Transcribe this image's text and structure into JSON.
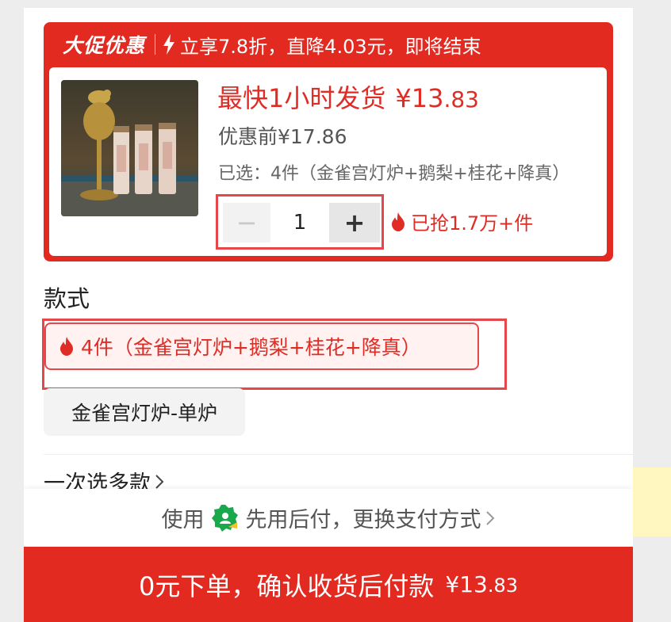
{
  "promo": {
    "badge": "大促优惠",
    "text": "立享7.8折，直降4.03元，即将结束",
    "ship_text": "最快1小时发货",
    "price_int": "¥13",
    "price_dec": ".83",
    "original_price": "优惠前¥17.86",
    "selected": "已选：4件（金雀宫灯炉+鹅梨+桂花+降真）",
    "quantity": "1",
    "minus": "−",
    "plus": "+",
    "sold": "已抢1.7万+件"
  },
  "style_section": {
    "title": "款式",
    "options": [
      {
        "label": "4件（金雀宫灯炉+鹅梨+桂花+降真）",
        "selected": true
      },
      {
        "label": "金雀宫灯炉-单炉",
        "selected": false
      }
    ]
  },
  "multi_select": {
    "label": "一次选多款"
  },
  "payment": {
    "prefix": "使用",
    "method": "先用后付，更换支付方式"
  },
  "cta": {
    "label": "0元下单，确认收货后付款",
    "amount_int": "¥13",
    "amount_dec": ".83"
  },
  "colors": {
    "brand_red": "#e22a21",
    "highlight_border": "#e5474a",
    "pay_green": "#1aa84d"
  }
}
